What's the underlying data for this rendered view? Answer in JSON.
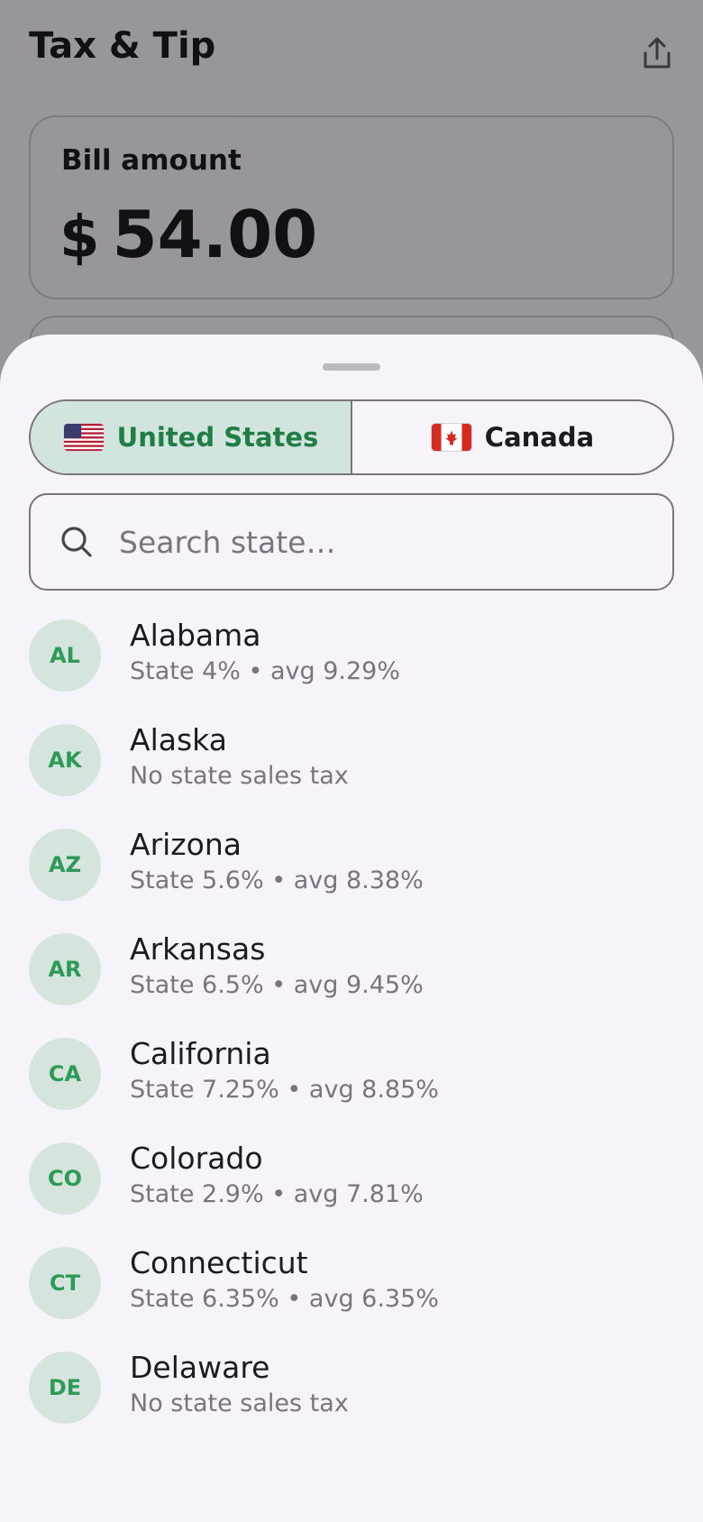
{
  "app": {
    "title": "Tax & Tip",
    "share_icon": "share-icon",
    "bill": {
      "label": "Bill amount",
      "currency": "$",
      "value": "54.00"
    }
  },
  "sheet": {
    "countries": [
      {
        "label": "United States",
        "flag_icon": "us-flag-icon",
        "selected": true
      },
      {
        "label": "Canada",
        "flag_icon": "canada-flag-icon",
        "selected": false
      }
    ],
    "search": {
      "placeholder": "Search state…",
      "value": ""
    },
    "states": [
      {
        "code": "AL",
        "name": "Alabama",
        "detail": "State 4% • avg 9.29%"
      },
      {
        "code": "AK",
        "name": "Alaska",
        "detail": "No state sales tax"
      },
      {
        "code": "AZ",
        "name": "Arizona",
        "detail": "State 5.6% • avg 8.38%"
      },
      {
        "code": "AR",
        "name": "Arkansas",
        "detail": "State 6.5% • avg 9.45%"
      },
      {
        "code": "CA",
        "name": "California",
        "detail": "State 7.25% • avg 8.85%"
      },
      {
        "code": "CO",
        "name": "Colorado",
        "detail": "State 2.9% • avg 7.81%"
      },
      {
        "code": "CT",
        "name": "Connecticut",
        "detail": "State 6.35% • avg 6.35%"
      },
      {
        "code": "DE",
        "name": "Delaware",
        "detail": "No state sales tax"
      }
    ]
  },
  "colors": {
    "accent": "#1f7d45",
    "selected_segment": "#d1e4dd",
    "avatar_bg": "#d5e5dd",
    "avatar_text": "#2e9a57",
    "sheet_bg": "#f7f3fa"
  }
}
